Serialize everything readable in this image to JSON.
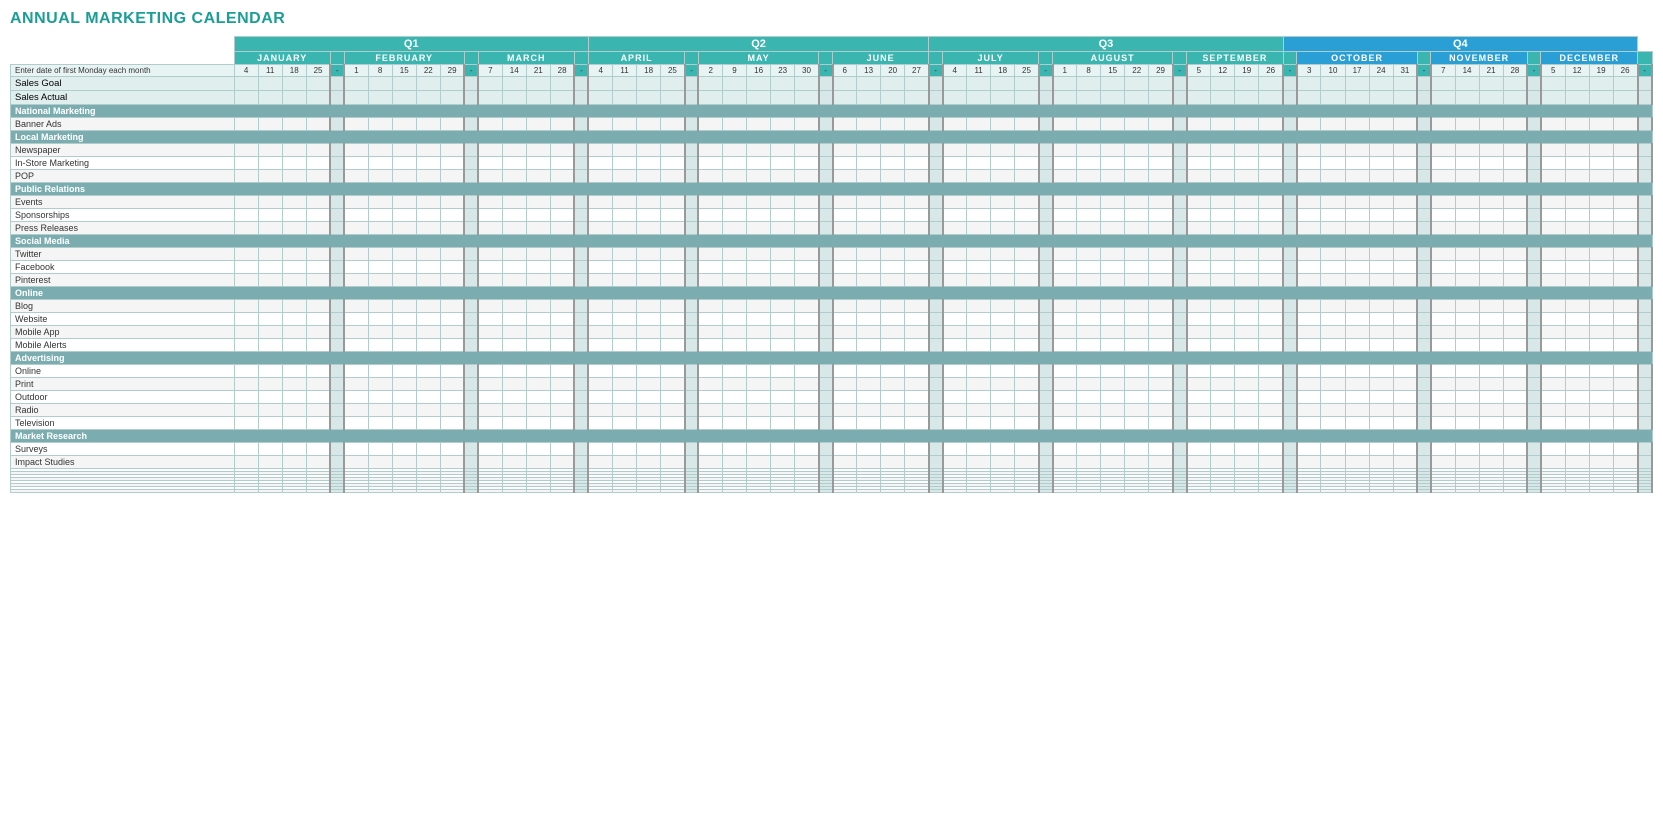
{
  "title": "ANNUAL MARKETING CALENDAR",
  "quarters": [
    {
      "label": "Q1",
      "span": 16,
      "color": "q1"
    },
    {
      "label": "Q2",
      "span": 15,
      "color": "q2"
    },
    {
      "label": "Q3",
      "span": 16,
      "color": "q3"
    },
    {
      "label": "Q4",
      "span": 16,
      "color": "q4"
    }
  ],
  "months": [
    {
      "label": "JANUARY",
      "days": [
        4,
        11,
        18,
        25
      ],
      "sep": true
    },
    {
      "label": "FEBRUARY",
      "days": [
        1,
        8,
        15,
        22,
        29
      ],
      "sep": true
    },
    {
      "label": "MARCH",
      "days": [
        7,
        14,
        21,
        28
      ],
      "sep": true
    },
    {
      "label": "APRIL",
      "days": [
        4,
        11,
        18,
        25
      ],
      "sep": true
    },
    {
      "label": "MAY",
      "days": [
        2,
        9,
        16,
        23,
        30
      ],
      "sep": true
    },
    {
      "label": "JUNE",
      "days": [
        6,
        13,
        20,
        27
      ],
      "sep": true
    },
    {
      "label": "JULY",
      "days": [
        4,
        11,
        18,
        25
      ],
      "sep": true
    },
    {
      "label": "AUGUST",
      "days": [
        1,
        8,
        15,
        22,
        29
      ],
      "sep": true
    },
    {
      "label": "SEPTEMBER",
      "days": [
        5,
        12,
        19,
        26
      ],
      "sep": true
    },
    {
      "label": "OCTOBER",
      "days": [
        3,
        10,
        17,
        24,
        31
      ],
      "sep": true
    },
    {
      "label": "NOVEMBER",
      "days": [
        7,
        14,
        21,
        28
      ],
      "sep": true
    },
    {
      "label": "DECEMBER",
      "days": [
        5,
        12,
        19,
        26
      ],
      "sep": false
    }
  ],
  "date_row_label": "Enter date of first Monday each month",
  "rows": [
    {
      "type": "special",
      "label": "Sales Goal"
    },
    {
      "type": "special",
      "label": "Sales Actual"
    },
    {
      "type": "category",
      "label": "National Marketing"
    },
    {
      "type": "data",
      "label": "Banner Ads"
    },
    {
      "type": "category",
      "label": "Local Marketing"
    },
    {
      "type": "data",
      "label": "Newspaper"
    },
    {
      "type": "data",
      "label": "In-Store Marketing"
    },
    {
      "type": "data",
      "label": "POP"
    },
    {
      "type": "category",
      "label": "Public Relations"
    },
    {
      "type": "data",
      "label": "Events"
    },
    {
      "type": "data",
      "label": "Sponsorships"
    },
    {
      "type": "data",
      "label": "Press Releases"
    },
    {
      "type": "category",
      "label": "Social Media"
    },
    {
      "type": "data",
      "label": "Twitter"
    },
    {
      "type": "data",
      "label": "Facebook"
    },
    {
      "type": "data",
      "label": "Pinterest"
    },
    {
      "type": "category",
      "label": "Online"
    },
    {
      "type": "data",
      "label": "Blog"
    },
    {
      "type": "data",
      "label": "Website"
    },
    {
      "type": "data",
      "label": "Mobile App"
    },
    {
      "type": "data",
      "label": "Mobile Alerts"
    },
    {
      "type": "category",
      "label": "Advertising"
    },
    {
      "type": "data",
      "label": "Online"
    },
    {
      "type": "data",
      "label": "Print"
    },
    {
      "type": "data",
      "label": "Outdoor"
    },
    {
      "type": "data",
      "label": "Radio"
    },
    {
      "type": "data",
      "label": "Television"
    },
    {
      "type": "category",
      "label": "Market Research"
    },
    {
      "type": "data",
      "label": "Surveys"
    },
    {
      "type": "data",
      "label": "Impact Studies"
    },
    {
      "type": "empty",
      "label": ""
    },
    {
      "type": "empty",
      "label": ""
    },
    {
      "type": "empty",
      "label": ""
    },
    {
      "type": "empty",
      "label": ""
    },
    {
      "type": "empty",
      "label": ""
    },
    {
      "type": "empty",
      "label": ""
    },
    {
      "type": "empty",
      "label": ""
    },
    {
      "type": "empty",
      "label": ""
    }
  ]
}
